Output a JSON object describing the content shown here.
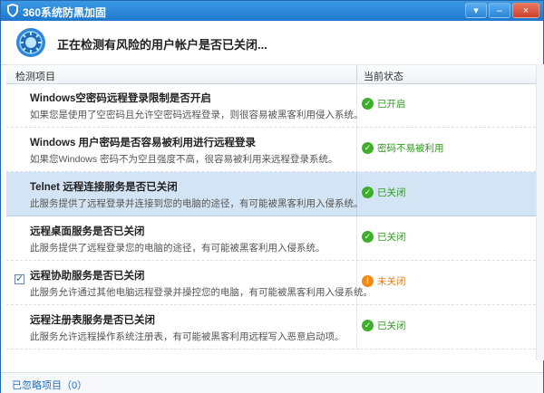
{
  "window": {
    "title": "360系统防黑加固",
    "controls": [
      "▾",
      "–",
      "×"
    ]
  },
  "header": {
    "status_text": "正在检测有风险的用户帐户是否已关闭..."
  },
  "table": {
    "columns": [
      "检测项目",
      "当前状态"
    ],
    "rows": [
      {
        "title": "Windows空密码远程登录限制是否开启",
        "desc": "如果您是使用了空密码且允许空密码远程登录，则很容易被黑客利用侵入系统。",
        "status": "已开启",
        "status_type": "ok",
        "checkbox": false,
        "selected": false
      },
      {
        "title": "Windows 用户密码是否容易被利用进行远程登录",
        "desc": "如果您Windows 密码不为空且强度不高，很容易被利用来远程登录系统。",
        "status": "密码不易被利用",
        "status_type": "ok",
        "checkbox": false,
        "selected": false
      },
      {
        "title": "Telnet 远程连接服务是否已关闭",
        "desc": "此服务提供了远程登录并连接到您的电脑的途径，有可能被黑客利用入侵系统。",
        "status": "已关闭",
        "status_type": "ok",
        "checkbox": false,
        "selected": true
      },
      {
        "title": "远程桌面服务是否已关闭",
        "desc": "此服务提供了远程登录您的电脑的途径，有可能被黑客利用入侵系统。",
        "status": "已关闭",
        "status_type": "ok",
        "checkbox": false,
        "selected": false
      },
      {
        "title": "远程协助服务是否已关闭",
        "desc": "此服务允许通过其他电脑远程登录并操控您的电脑，有可能被黑客利用入侵系统。",
        "status": "未关闭",
        "status_type": "warn",
        "checkbox": true,
        "selected": false
      },
      {
        "title": "远程注册表服务是否已关闭",
        "desc": "此服务允许远程操作系统注册表，有可能被黑客利用远程写入恶意启动项。",
        "status": "已关闭",
        "status_type": "ok",
        "checkbox": false,
        "selected": false
      }
    ]
  },
  "footer": {
    "ignored_items": "已忽略项目（0）"
  },
  "colors": {
    "titlebar": "#1f78cc",
    "ok": "#3fae2a",
    "warn": "#f08a12",
    "selected_row": "#d3e5f4"
  },
  "icons": {
    "status_ok": "check-circle-icon",
    "status_warn": "exclamation-circle-icon",
    "scan": "scan-icon",
    "app": "shield-icon"
  }
}
